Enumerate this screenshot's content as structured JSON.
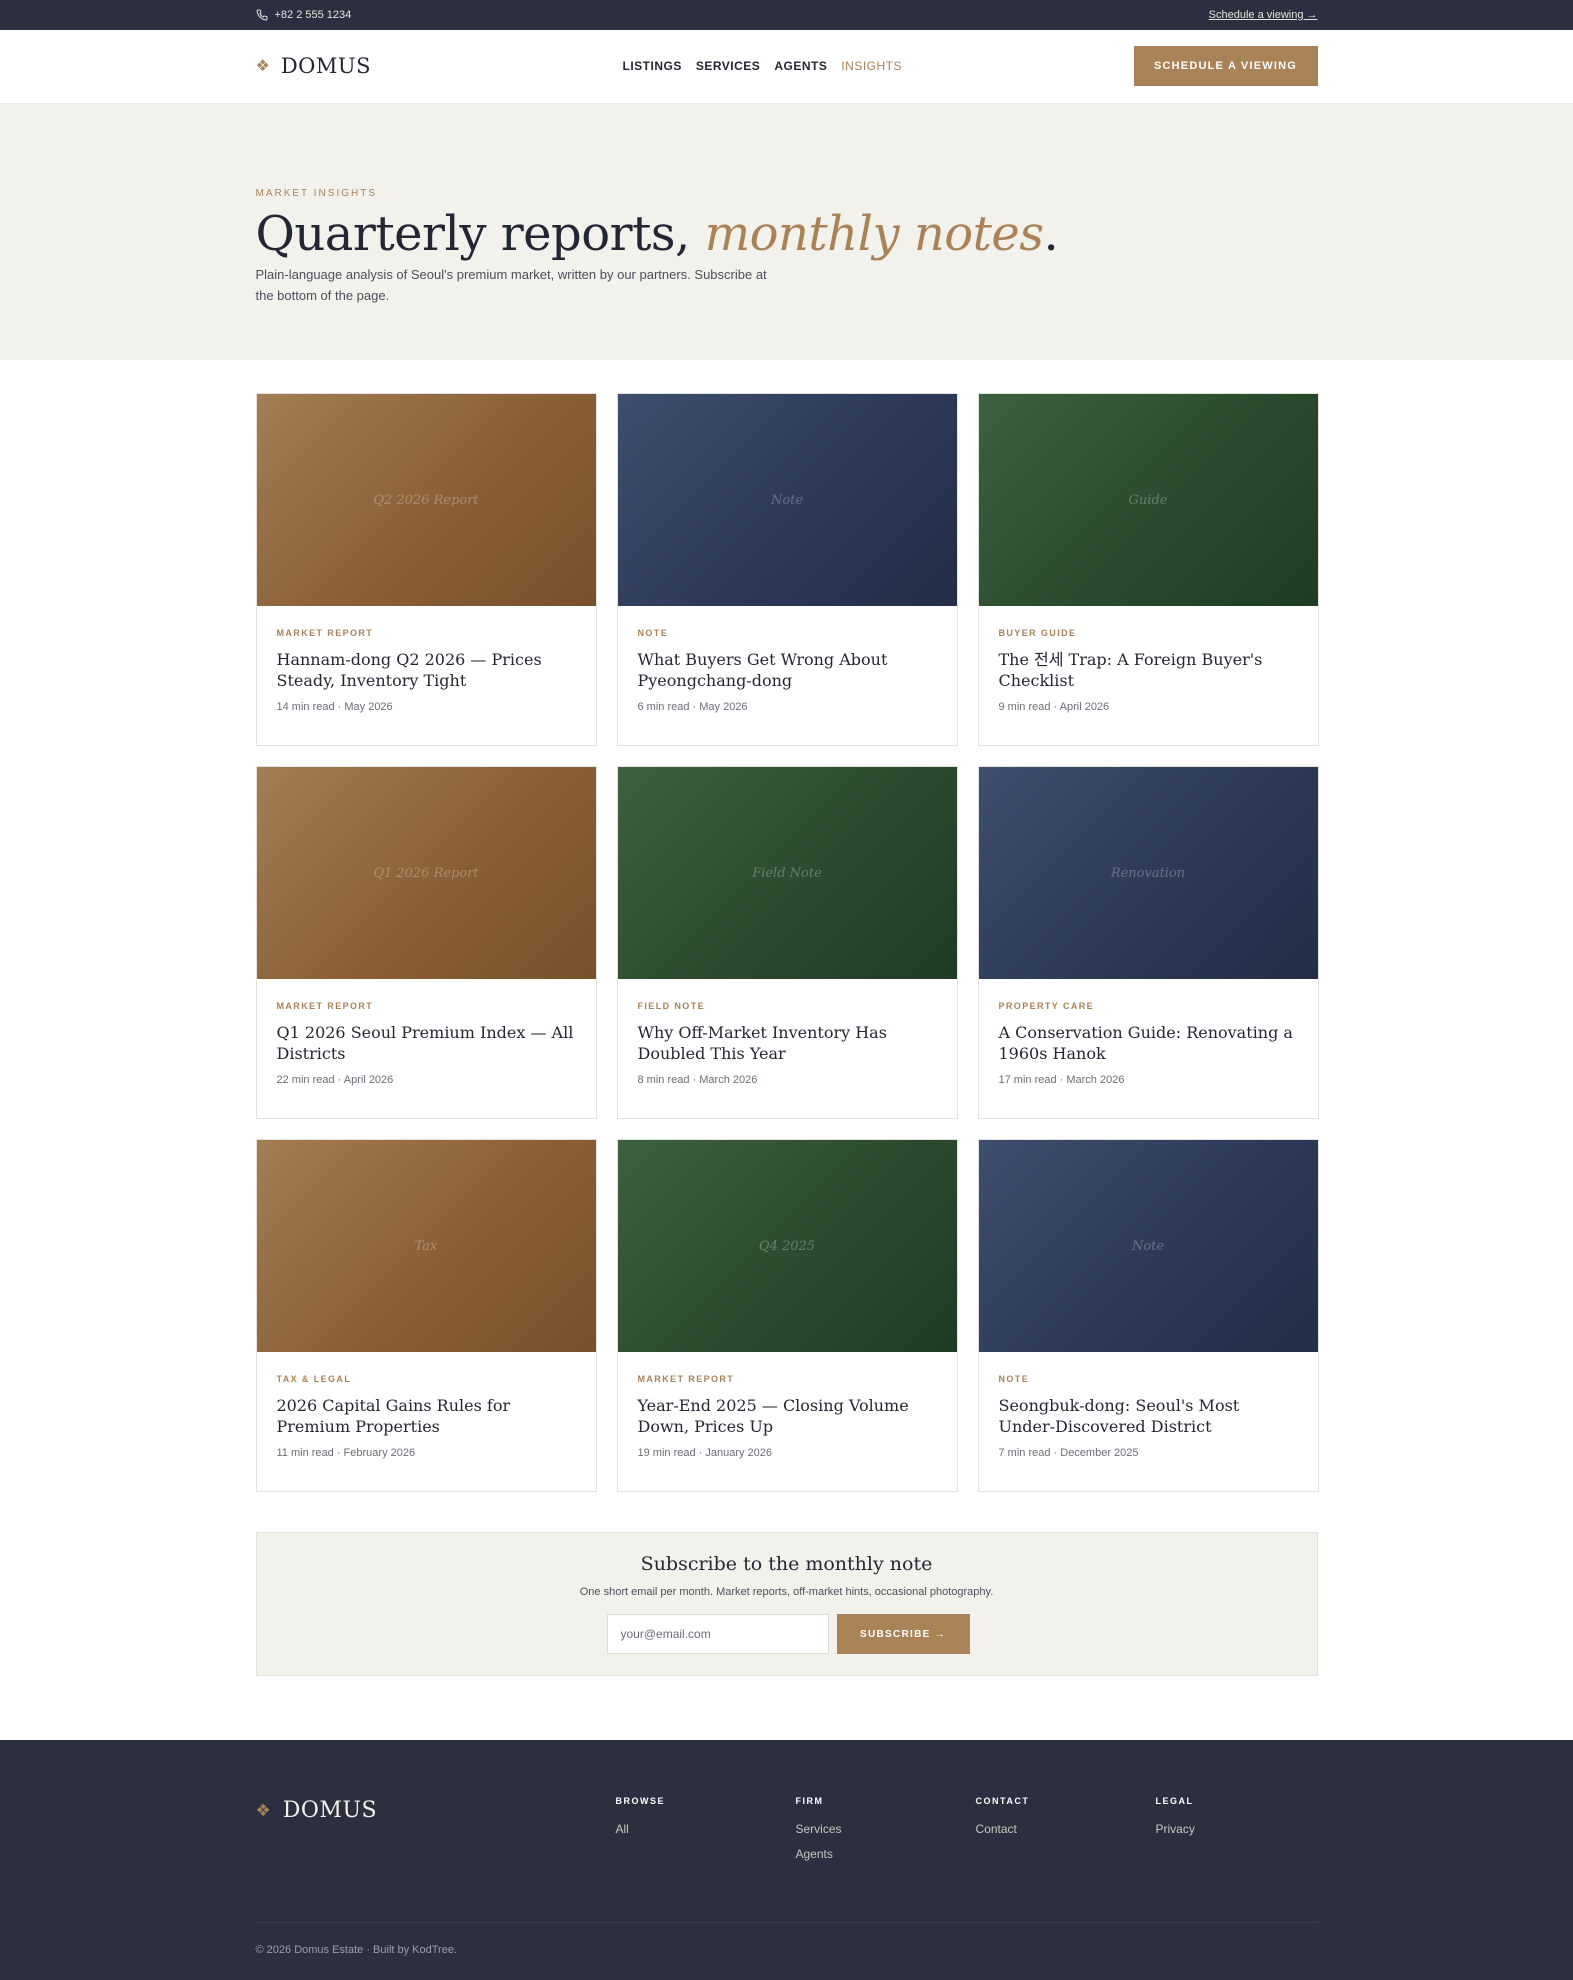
{
  "topbar": {
    "phone": "+82 2 555 1234",
    "schedule_link": "Schedule a viewing →"
  },
  "header": {
    "logo": "DOMUS",
    "nav": [
      {
        "label": "LISTINGS"
      },
      {
        "label": "SERVICES"
      },
      {
        "label": "AGENTS"
      },
      {
        "label": "INSIGHTS"
      }
    ],
    "cta": "SCHEDULE A VIEWING"
  },
  "hero": {
    "eyebrow": "MARKET INSIGHTS",
    "title_plain": "Quarterly reports, ",
    "title_accent": "monthly notes",
    "title_end": ".",
    "subtitle": "Plain-language analysis of Seoul's premium market, written by our partners. Subscribe at the bottom of the page."
  },
  "articles": [
    {
      "image_label": "Q2 2026 Report",
      "category": "MARKET REPORT",
      "title": "Hannam-dong Q2 2026 — Prices Steady, Inventory Tight",
      "meta": "14 min read · May 2026",
      "tone": "bronze"
    },
    {
      "image_label": "Note",
      "category": "NOTE",
      "title": "What Buyers Get Wrong About Pyeongchang-dong",
      "meta": "6 min read · May 2026",
      "tone": "navy"
    },
    {
      "image_label": "Guide",
      "category": "BUYER GUIDE",
      "title": "The 전세 Trap: A Foreign Buyer's Checklist",
      "meta": "9 min read · April 2026",
      "tone": "green"
    },
    {
      "image_label": "Q1 2026 Report",
      "category": "MARKET REPORT",
      "title": "Q1 2026 Seoul Premium Index — All Districts",
      "meta": "22 min read · April 2026",
      "tone": "bronze"
    },
    {
      "image_label": "Field Note",
      "category": "FIELD NOTE",
      "title": "Why Off-Market Inventory Has Doubled This Year",
      "meta": "8 min read · March 2026",
      "tone": "green"
    },
    {
      "image_label": "Renovation",
      "category": "PROPERTY CARE",
      "title": "A Conservation Guide: Renovating a 1960s Hanok",
      "meta": "17 min read · March 2026",
      "tone": "navy"
    },
    {
      "image_label": "Tax",
      "category": "TAX & LEGAL",
      "title": "2026 Capital Gains Rules for Premium Properties",
      "meta": "11 min read · February 2026",
      "tone": "bronze"
    },
    {
      "image_label": "Q4 2025",
      "category": "MARKET REPORT",
      "title": "Year-End 2025 — Closing Volume Down, Prices Up",
      "meta": "19 min read · January 2026",
      "tone": "green"
    },
    {
      "image_label": "Note",
      "category": "NOTE",
      "title": "Seongbuk-dong: Seoul's Most Under-Discovered District",
      "meta": "7 min read · December 2025",
      "tone": "navy"
    }
  ],
  "subscribe": {
    "title": "Subscribe to the monthly note",
    "text": "One short email per month. Market reports, off-market hints, occasional photography.",
    "placeholder": "your@email.com",
    "button": "SUBSCRIBE →"
  },
  "footer": {
    "logo": "DOMUS",
    "columns": [
      {
        "heading": "BROWSE",
        "links": [
          "All"
        ]
      },
      {
        "heading": "FIRM",
        "links": [
          "Services",
          "Agents"
        ]
      },
      {
        "heading": "CONTACT",
        "links": [
          "Contact"
        ]
      },
      {
        "heading": "LEGAL",
        "links": [
          "Privacy"
        ]
      }
    ],
    "copyright": "© 2026 Domus Estate · Built by KodTree."
  },
  "colors": {
    "accent": "#a98357",
    "dark": "#2b2f40",
    "cream": "#f3f1ec"
  },
  "icons": {
    "phone": "phone-icon",
    "logo_mark": "diamond-cluster-icon"
  }
}
